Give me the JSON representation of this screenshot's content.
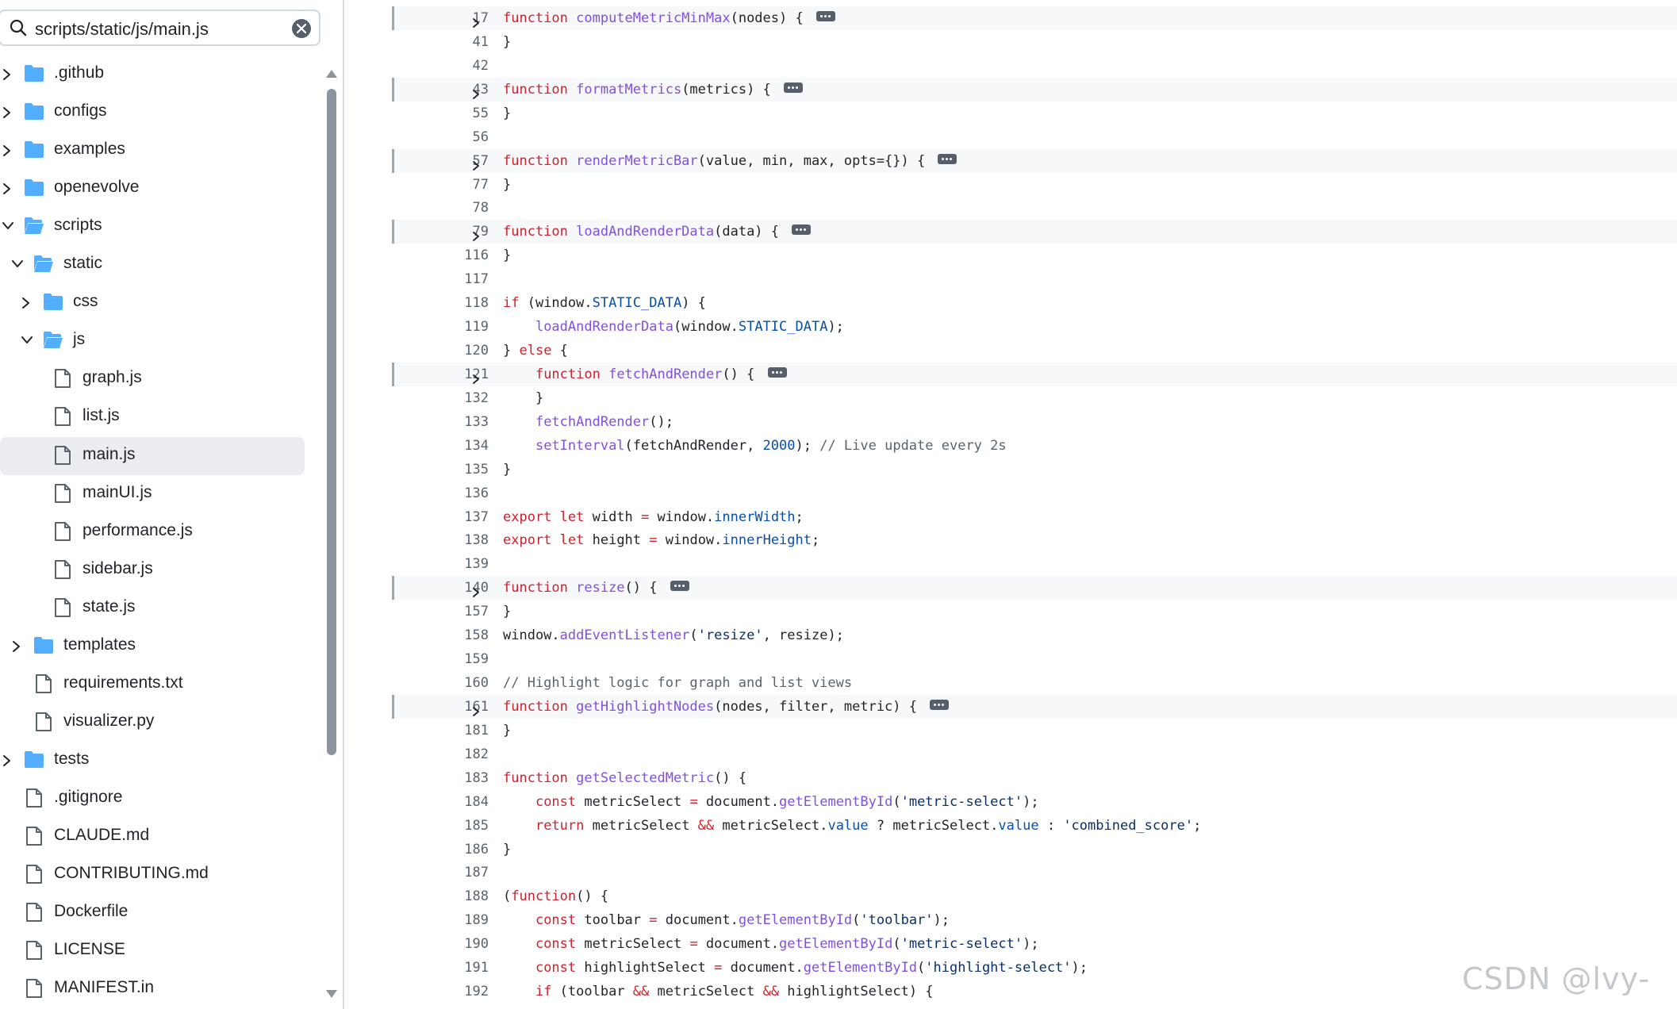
{
  "search": {
    "value": "scripts/static/js/main.js"
  },
  "tree": {
    "items": [
      {
        "label": ".github",
        "type": "folder",
        "depth": 0,
        "expanded": false
      },
      {
        "label": "configs",
        "type": "folder",
        "depth": 0,
        "expanded": false
      },
      {
        "label": "examples",
        "type": "folder",
        "depth": 0,
        "expanded": false
      },
      {
        "label": "openevolve",
        "type": "folder",
        "depth": 0,
        "expanded": false
      },
      {
        "label": "scripts",
        "type": "folder",
        "depth": 0,
        "expanded": true
      },
      {
        "label": "static",
        "type": "folder",
        "depth": 1,
        "expanded": true
      },
      {
        "label": "css",
        "type": "folder",
        "depth": 2,
        "expanded": false
      },
      {
        "label": "js",
        "type": "folder",
        "depth": 2,
        "expanded": true
      },
      {
        "label": "graph.js",
        "type": "file",
        "depth": 3
      },
      {
        "label": "list.js",
        "type": "file",
        "depth": 3
      },
      {
        "label": "main.js",
        "type": "file",
        "depth": 3,
        "selected": true
      },
      {
        "label": "mainUI.js",
        "type": "file",
        "depth": 3
      },
      {
        "label": "performance.js",
        "type": "file",
        "depth": 3
      },
      {
        "label": "sidebar.js",
        "type": "file",
        "depth": 3
      },
      {
        "label": "state.js",
        "type": "file",
        "depth": 3
      },
      {
        "label": "templates",
        "type": "folder",
        "depth": 1,
        "expanded": false
      },
      {
        "label": "requirements.txt",
        "type": "file",
        "depth": 1
      },
      {
        "label": "visualizer.py",
        "type": "file",
        "depth": 1
      },
      {
        "label": "tests",
        "type": "folder",
        "depth": 0,
        "expanded": false
      },
      {
        "label": ".gitignore",
        "type": "file",
        "depth": 0
      },
      {
        "label": "CLAUDE.md",
        "type": "file",
        "depth": 0
      },
      {
        "label": "CONTRIBUTING.md",
        "type": "file",
        "depth": 0
      },
      {
        "label": "Dockerfile",
        "type": "file",
        "depth": 0
      },
      {
        "label": "LICENSE",
        "type": "file",
        "depth": 0
      },
      {
        "label": "MANIFEST.in",
        "type": "file",
        "depth": 0
      }
    ]
  },
  "code": {
    "lines": [
      {
        "n": "17",
        "fold": true,
        "t": [
          [
            "k",
            "function "
          ],
          [
            "f",
            "computeMetricMinMax"
          ],
          [
            "",
            "(nodes) { "
          ]
        ]
      },
      {
        "n": "41",
        "t": [
          [
            "",
            "}"
          ]
        ]
      },
      {
        "n": "42",
        "t": []
      },
      {
        "n": "43",
        "fold": true,
        "t": [
          [
            "k",
            "function "
          ],
          [
            "f",
            "formatMetrics"
          ],
          [
            "",
            "(metrics) { "
          ]
        ]
      },
      {
        "n": "55",
        "t": [
          [
            "",
            "}"
          ]
        ]
      },
      {
        "n": "56",
        "t": []
      },
      {
        "n": "57",
        "fold": true,
        "t": [
          [
            "k",
            "function "
          ],
          [
            "f",
            "renderMetricBar"
          ],
          [
            "",
            "(value, min, max, opts={}) { "
          ]
        ]
      },
      {
        "n": "77",
        "t": [
          [
            "",
            "}"
          ]
        ]
      },
      {
        "n": "78",
        "t": []
      },
      {
        "n": "79",
        "fold": true,
        "t": [
          [
            "k",
            "function "
          ],
          [
            "f",
            "loadAndRenderData"
          ],
          [
            "",
            "(data) { "
          ]
        ]
      },
      {
        "n": "116",
        "t": [
          [
            "",
            "}"
          ]
        ]
      },
      {
        "n": "117",
        "t": []
      },
      {
        "n": "118",
        "t": [
          [
            "k",
            "if"
          ],
          [
            "",
            " (window."
          ],
          [
            "c",
            "STATIC_DATA"
          ],
          [
            "",
            ") {"
          ]
        ]
      },
      {
        "n": "119",
        "t": [
          [
            "",
            "    "
          ],
          [
            "f",
            "loadAndRenderData"
          ],
          [
            "",
            "(window."
          ],
          [
            "c",
            "STATIC_DATA"
          ],
          [
            "",
            ");"
          ]
        ]
      },
      {
        "n": "120",
        "t": [
          [
            "",
            "} "
          ],
          [
            "k",
            "else"
          ],
          [
            "",
            " {"
          ]
        ]
      },
      {
        "n": "121",
        "fold": true,
        "t": [
          [
            "",
            "    "
          ],
          [
            "k",
            "function "
          ],
          [
            "f",
            "fetchAndRender"
          ],
          [
            "",
            "() { "
          ]
        ]
      },
      {
        "n": "132",
        "t": [
          [
            "",
            "    }"
          ]
        ]
      },
      {
        "n": "133",
        "t": [
          [
            "",
            "    "
          ],
          [
            "f",
            "fetchAndRender"
          ],
          [
            "",
            "();"
          ]
        ]
      },
      {
        "n": "134",
        "t": [
          [
            "",
            "    "
          ],
          [
            "f",
            "setInterval"
          ],
          [
            "",
            "(fetchAndRender, "
          ],
          [
            "c",
            "2000"
          ],
          [
            "",
            "); "
          ],
          [
            "cm",
            "// Live update every 2s"
          ]
        ]
      },
      {
        "n": "135",
        "t": [
          [
            "",
            "}"
          ]
        ]
      },
      {
        "n": "136",
        "t": []
      },
      {
        "n": "137",
        "t": [
          [
            "k",
            "export "
          ],
          [
            "k",
            "let "
          ],
          [
            "",
            "width "
          ],
          [
            "k",
            "="
          ],
          [
            "",
            " window."
          ],
          [
            "c",
            "innerWidth"
          ],
          [
            "",
            ";"
          ]
        ]
      },
      {
        "n": "138",
        "t": [
          [
            "k",
            "export "
          ],
          [
            "k",
            "let "
          ],
          [
            "",
            "height "
          ],
          [
            "k",
            "="
          ],
          [
            "",
            " window."
          ],
          [
            "c",
            "innerHeight"
          ],
          [
            "",
            ";"
          ]
        ]
      },
      {
        "n": "139",
        "t": []
      },
      {
        "n": "140",
        "fold": true,
        "t": [
          [
            "k",
            "function "
          ],
          [
            "f",
            "resize"
          ],
          [
            "",
            "() { "
          ]
        ]
      },
      {
        "n": "157",
        "t": [
          [
            "",
            "}"
          ]
        ]
      },
      {
        "n": "158",
        "t": [
          [
            "",
            "window."
          ],
          [
            "f",
            "addEventListener"
          ],
          [
            "",
            "("
          ],
          [
            "s",
            "'resize'"
          ],
          [
            "",
            ", resize);"
          ]
        ]
      },
      {
        "n": "159",
        "t": []
      },
      {
        "n": "160",
        "t": [
          [
            "cm",
            "// Highlight logic for graph and list views"
          ]
        ]
      },
      {
        "n": "161",
        "fold": true,
        "t": [
          [
            "k",
            "function "
          ],
          [
            "f",
            "getHighlightNodes"
          ],
          [
            "",
            "(nodes, filter, metric) { "
          ]
        ]
      },
      {
        "n": "181",
        "t": [
          [
            "",
            "}"
          ]
        ]
      },
      {
        "n": "182",
        "t": []
      },
      {
        "n": "183",
        "t": [
          [
            "k",
            "function "
          ],
          [
            "f",
            "getSelectedMetric"
          ],
          [
            "",
            "() {"
          ]
        ]
      },
      {
        "n": "184",
        "t": [
          [
            "",
            "    "
          ],
          [
            "k",
            "const "
          ],
          [
            "",
            "metricSelect "
          ],
          [
            "k",
            "="
          ],
          [
            "",
            " document."
          ],
          [
            "f",
            "getElementById"
          ],
          [
            "",
            "("
          ],
          [
            "s",
            "'metric-select'"
          ],
          [
            "",
            ");"
          ]
        ]
      },
      {
        "n": "185",
        "t": [
          [
            "",
            "    "
          ],
          [
            "k",
            "return "
          ],
          [
            "",
            "metricSelect "
          ],
          [
            "k",
            "&&"
          ],
          [
            "",
            " metricSelect."
          ],
          [
            "c",
            "value"
          ],
          [
            "",
            " ? metricSelect."
          ],
          [
            "c",
            "value"
          ],
          [
            "",
            " : "
          ],
          [
            "s",
            "'combined_score'"
          ],
          [
            "",
            ";"
          ]
        ]
      },
      {
        "n": "186",
        "t": [
          [
            "",
            "}"
          ]
        ]
      },
      {
        "n": "187",
        "t": []
      },
      {
        "n": "188",
        "t": [
          [
            "",
            "("
          ],
          [
            "k",
            "function"
          ],
          [
            "",
            "() {"
          ]
        ]
      },
      {
        "n": "189",
        "t": [
          [
            "",
            "    "
          ],
          [
            "k",
            "const "
          ],
          [
            "",
            "toolbar "
          ],
          [
            "k",
            "="
          ],
          [
            "",
            " document."
          ],
          [
            "f",
            "getElementById"
          ],
          [
            "",
            "("
          ],
          [
            "s",
            "'toolbar'"
          ],
          [
            "",
            ");"
          ]
        ]
      },
      {
        "n": "190",
        "t": [
          [
            "",
            "    "
          ],
          [
            "k",
            "const "
          ],
          [
            "",
            "metricSelect "
          ],
          [
            "k",
            "="
          ],
          [
            "",
            " document."
          ],
          [
            "f",
            "getElementById"
          ],
          [
            "",
            "("
          ],
          [
            "s",
            "'metric-select'"
          ],
          [
            "",
            ");"
          ]
        ]
      },
      {
        "n": "191",
        "t": [
          [
            "",
            "    "
          ],
          [
            "k",
            "const "
          ],
          [
            "",
            "highlightSelect "
          ],
          [
            "k",
            "="
          ],
          [
            "",
            " document."
          ],
          [
            "f",
            "getElementById"
          ],
          [
            "",
            "("
          ],
          [
            "s",
            "'highlight-select'"
          ],
          [
            "",
            ");"
          ]
        ]
      },
      {
        "n": "192",
        "t": [
          [
            "",
            "    "
          ],
          [
            "k",
            "if"
          ],
          [
            "",
            " (toolbar "
          ],
          [
            "k",
            "&&"
          ],
          [
            "",
            " metricSelect "
          ],
          [
            "k",
            "&&"
          ],
          [
            "",
            " highlightSelect) {"
          ]
        ]
      }
    ]
  },
  "watermark": "CSDN @lvy-",
  "colors": {
    "keyword": "#cf222e",
    "function": "#8250df",
    "constant": "#0550ae",
    "string": "#0a3069",
    "comment": "#59636e",
    "folder": "#54aeff",
    "selected_row": "#ebedf0"
  }
}
